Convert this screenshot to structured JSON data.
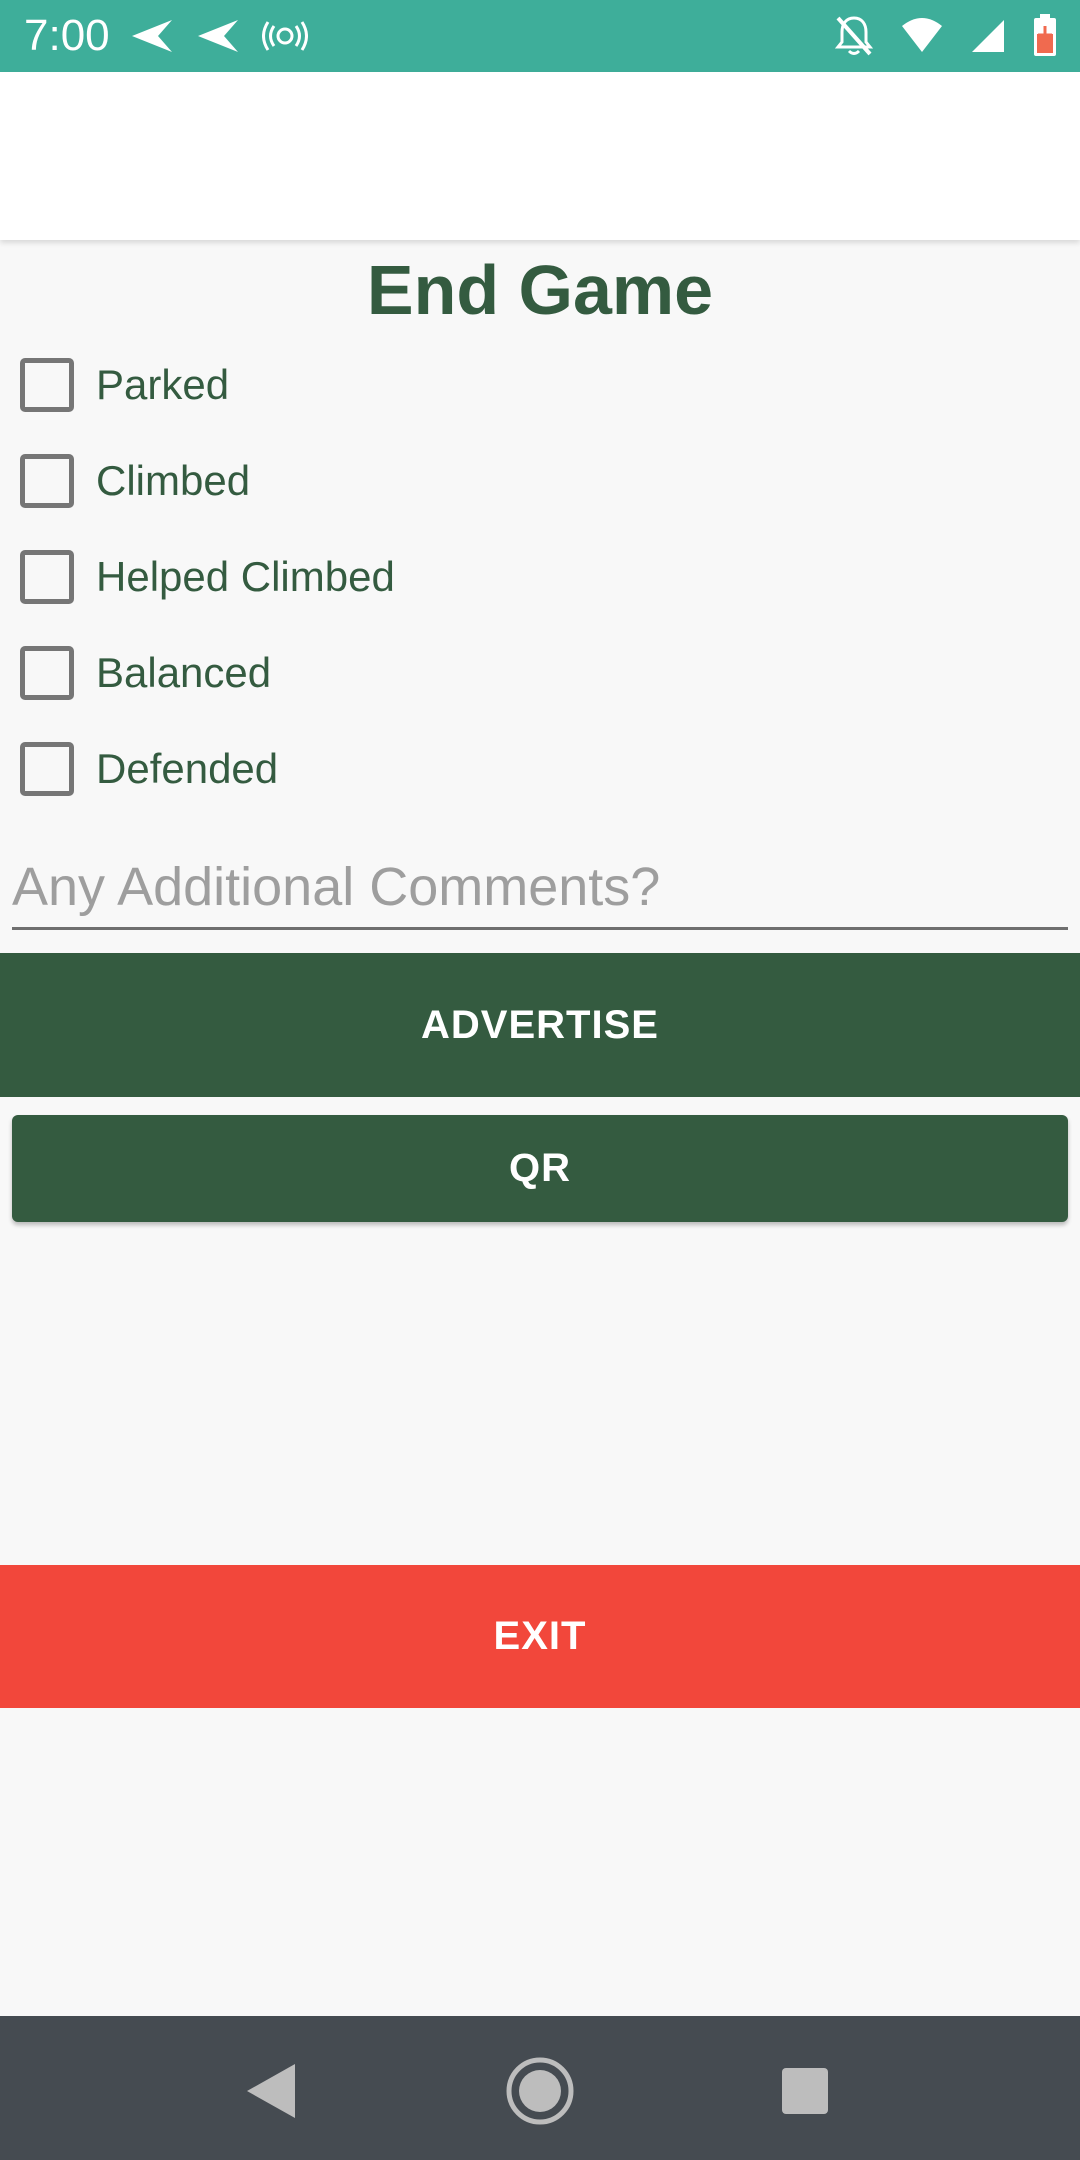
{
  "status_bar": {
    "time": "7:00",
    "icons_left": [
      "send-icon",
      "send-icon",
      "hotspot-icon"
    ],
    "icons_right": [
      "notifications-off-icon",
      "wifi-icon",
      "signal-icon",
      "battery-charging-icon"
    ]
  },
  "page": {
    "title": "End Game"
  },
  "checkboxes": [
    {
      "label": "Parked",
      "checked": false
    },
    {
      "label": "Climbed",
      "checked": false
    },
    {
      "label": "Helped Climbed",
      "checked": false
    },
    {
      "label": "Balanced",
      "checked": false
    },
    {
      "label": "Defended",
      "checked": false
    }
  ],
  "comments": {
    "placeholder": "Any Additional Comments?",
    "value": ""
  },
  "buttons": {
    "advertise": "ADVERTISE",
    "qr": "QR",
    "exit": "EXIT"
  },
  "colors": {
    "status_bar": "#3eae9a",
    "primary": "#345b40",
    "exit": "#f2473b",
    "nav_bar": "#454b51"
  },
  "nav_bar": {
    "icons": [
      "back-icon",
      "home-icon",
      "recents-icon"
    ]
  }
}
